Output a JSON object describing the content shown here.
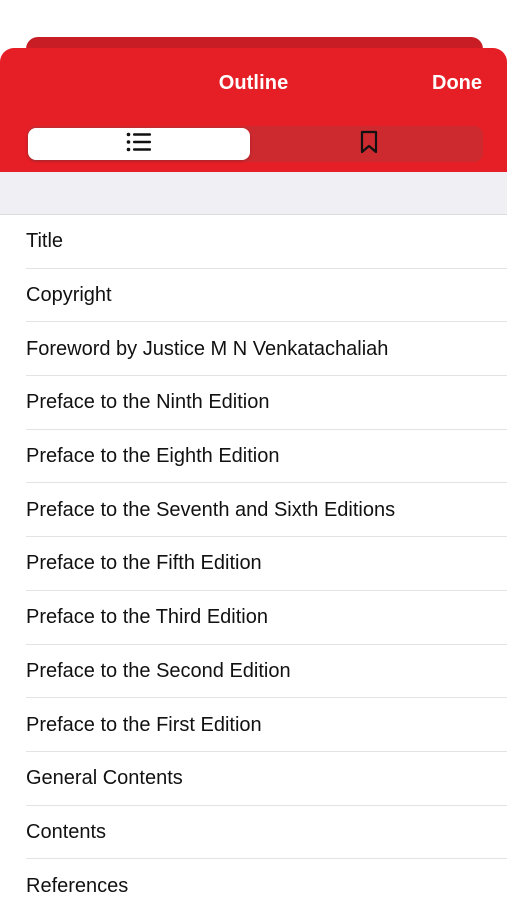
{
  "header": {
    "title": "Outline",
    "done_label": "Done"
  },
  "segments": [
    {
      "icon": "list-icon",
      "selected": true
    },
    {
      "icon": "bookmark-icon",
      "selected": false
    }
  ],
  "colors": {
    "accent": "#e61e26",
    "back_sheet": "#c81d25",
    "subbar": "#efeff4"
  },
  "outline": {
    "items": [
      "Title",
      "Copyright",
      "Foreword by Justice M N Venkatachaliah",
      "Preface to the Ninth Edition",
      "Preface to the Eighth Edition",
      "Preface to the Seventh and Sixth Editions",
      "Preface to the Fifth Edition",
      "Preface to the Third Edition",
      "Preface to the Second Edition",
      "Preface to the First Edition",
      "General Contents",
      "Contents",
      "References"
    ]
  }
}
